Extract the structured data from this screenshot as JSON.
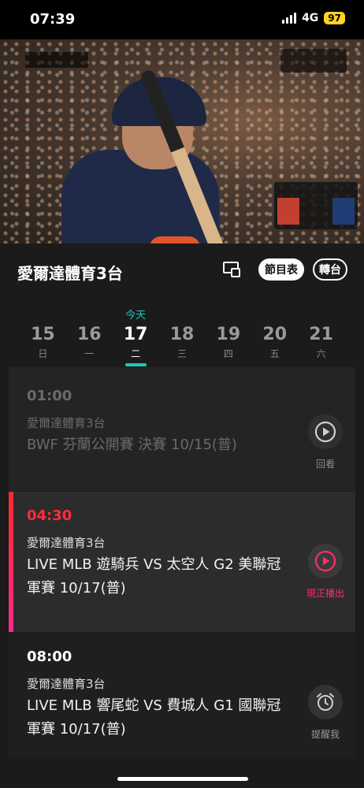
{
  "status_bar": {
    "time": "07:39",
    "network": "4G",
    "battery": "97"
  },
  "channel": {
    "name": "愛爾達體育3台",
    "schedule_label": "節目表",
    "switch_label": "轉台"
  },
  "dates": [
    {
      "day": "15",
      "weekday": "日",
      "today_label": "",
      "active": false
    },
    {
      "day": "16",
      "weekday": "一",
      "today_label": "",
      "active": false
    },
    {
      "day": "17",
      "weekday": "二",
      "today_label": "今天",
      "active": true
    },
    {
      "day": "18",
      "weekday": "三",
      "today_label": "",
      "active": false
    },
    {
      "day": "19",
      "weekday": "四",
      "today_label": "",
      "active": false
    },
    {
      "day": "20",
      "weekday": "五",
      "today_label": "",
      "active": false
    },
    {
      "day": "21",
      "weekday": "六",
      "today_label": "",
      "active": false
    }
  ],
  "programs": [
    {
      "time": "01:00",
      "channel": "愛爾達體育3台",
      "title": "BWF 芬蘭公開賽 決賽 10/15(普)",
      "action_label": "回看",
      "action_icon": "play-circle-icon",
      "state": "past"
    },
    {
      "time": "04:30",
      "channel": "愛爾達體育3台",
      "title": "LIVE MLB 遊騎兵 VS 太空人 G2 美聯冠軍賽 10/17(普)",
      "action_label": "現正播出",
      "action_icon": "play-circle-icon",
      "state": "live"
    },
    {
      "time": "08:00",
      "channel": "愛爾達體育3台",
      "title": "LIVE MLB 響尾蛇 VS 費城人 G1 國聯冠軍賽 10/17(普)",
      "action_label": "提醒我",
      "action_icon": "alarm-clock-icon",
      "state": "upcoming"
    }
  ],
  "colors": {
    "accent": "#1fc8b4",
    "live": "#ff2d3a",
    "background": "#1b1b1b"
  }
}
